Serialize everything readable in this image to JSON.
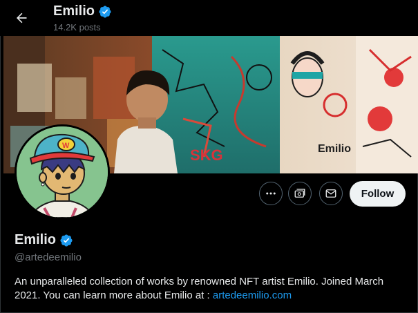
{
  "header": {
    "name": "Emilio",
    "posts": "14.2K posts",
    "back_icon": "arrow-left-icon",
    "verified_icon": "verified-badge-icon"
  },
  "actions": {
    "more_icon": "more-dots-icon",
    "subscribe_icon": "subscribe-money-icon",
    "message_icon": "envelope-icon",
    "follow_label": "Follow"
  },
  "profile": {
    "name": "Emilio",
    "handle": "@artedeemilio",
    "bio_text": "An unparalleled collection of works by renowned NFT artist Emilio. Joined March 2021. You can learn more about Emilio at : ",
    "bio_link": "artedeemilio.com",
    "verified_color": "#1d9bf0"
  },
  "banner": {
    "description_icon": "banner-photo",
    "painted_text_1": "Emilio",
    "painted_text_2": "SKG"
  },
  "colors": {
    "background": "#000000",
    "text": "#e7e9ea",
    "muted": "#71767b",
    "link": "#1d9bf0",
    "follow_bg": "#eff3f4"
  }
}
